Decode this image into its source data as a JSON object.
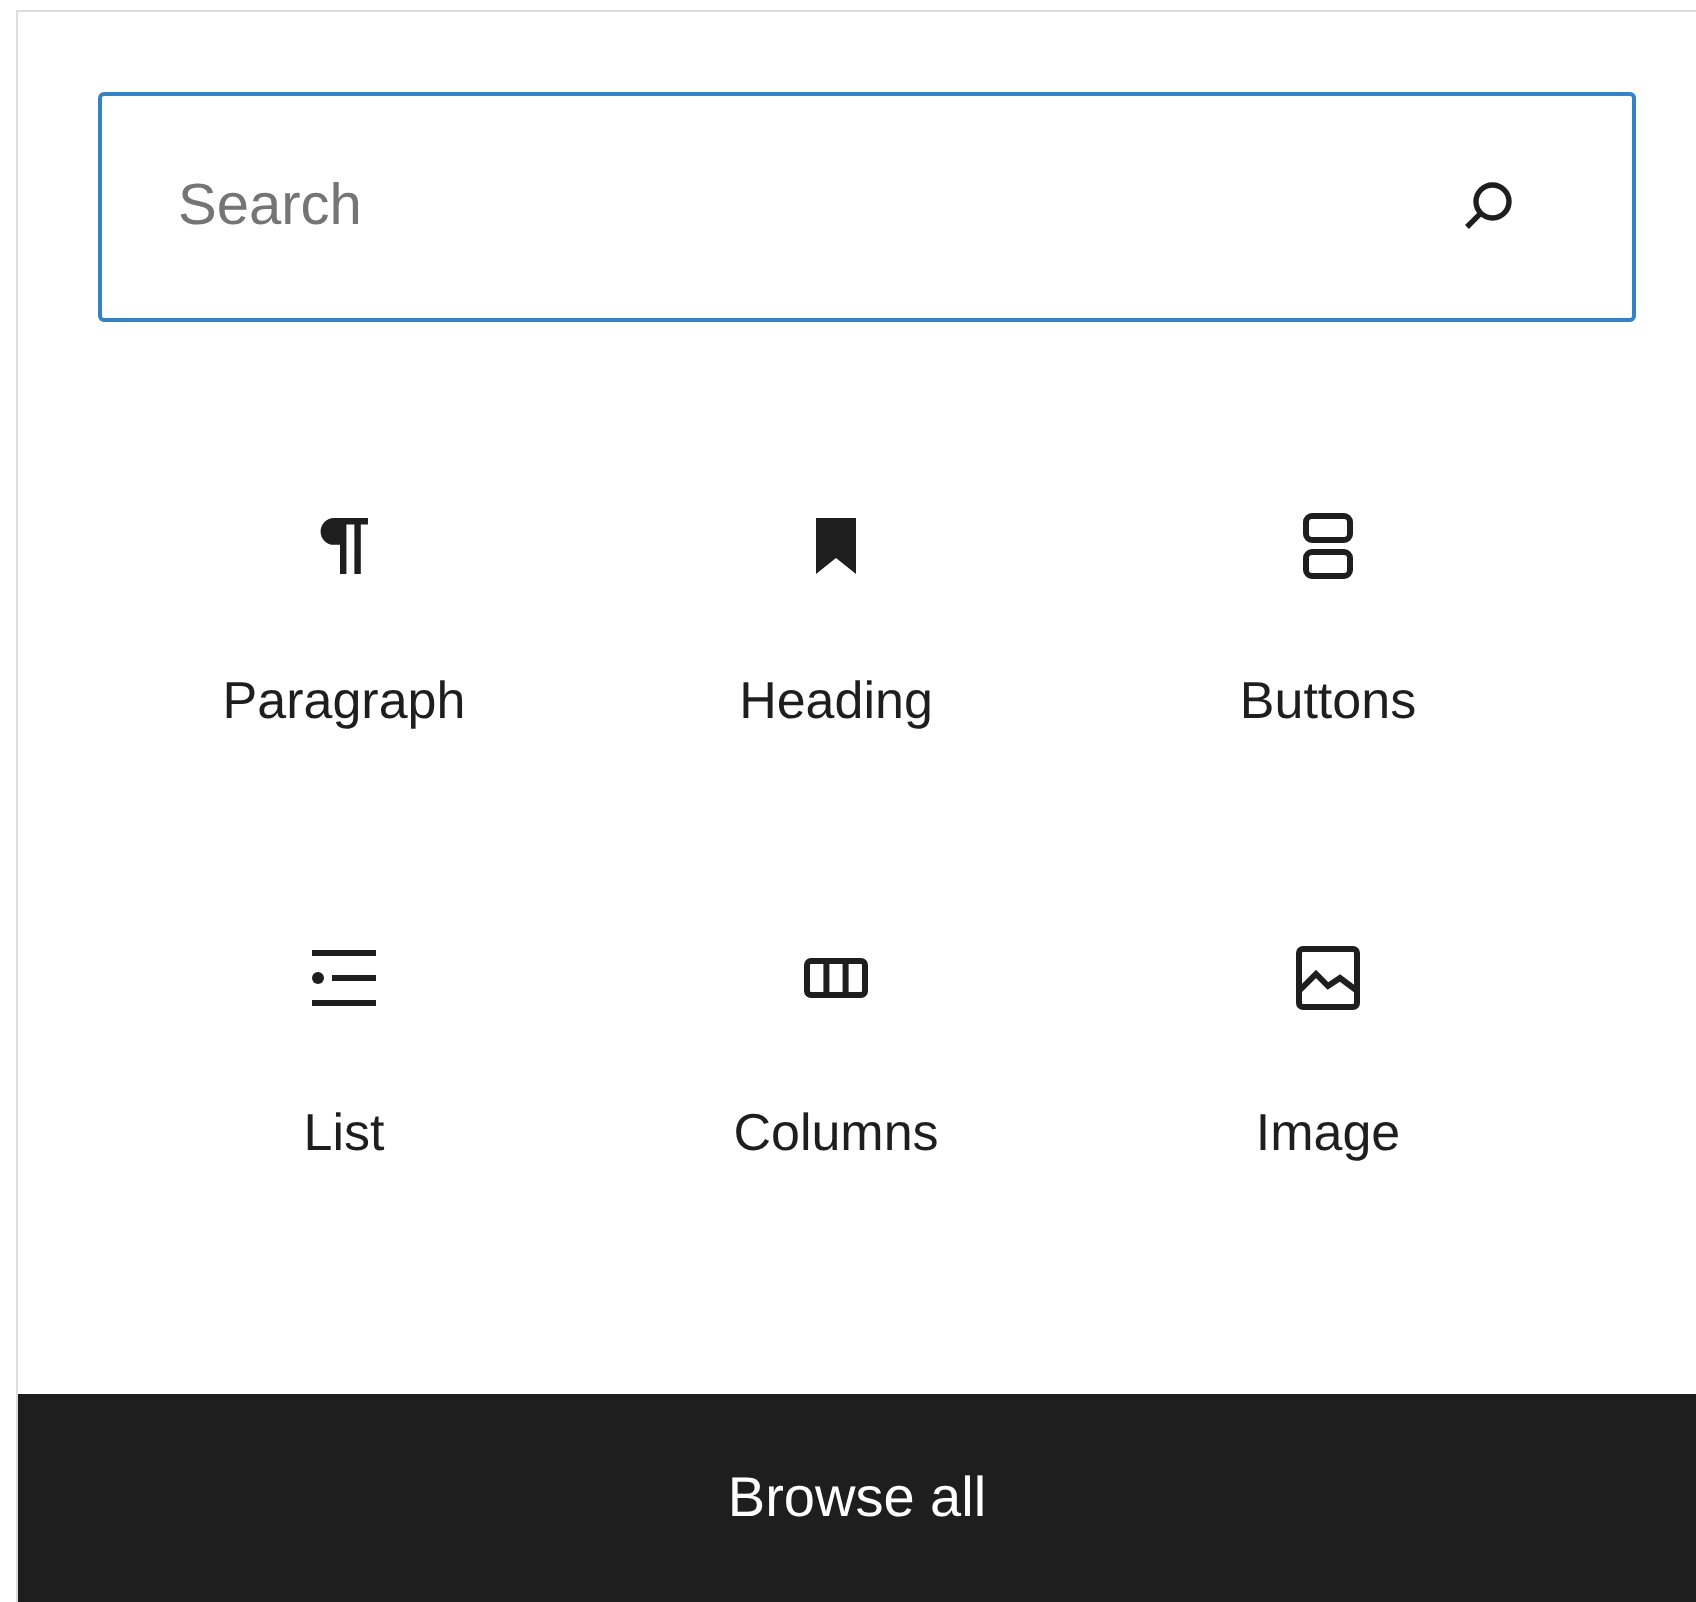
{
  "search": {
    "placeholder": "Search"
  },
  "blocks": [
    {
      "label": "Paragraph",
      "kind": "paragraph"
    },
    {
      "label": "Heading",
      "kind": "heading"
    },
    {
      "label": "Buttons",
      "kind": "buttons"
    },
    {
      "label": "List",
      "kind": "list"
    },
    {
      "label": "Columns",
      "kind": "columns"
    },
    {
      "label": "Image",
      "kind": "image"
    }
  ],
  "footer_button": "Browse all"
}
